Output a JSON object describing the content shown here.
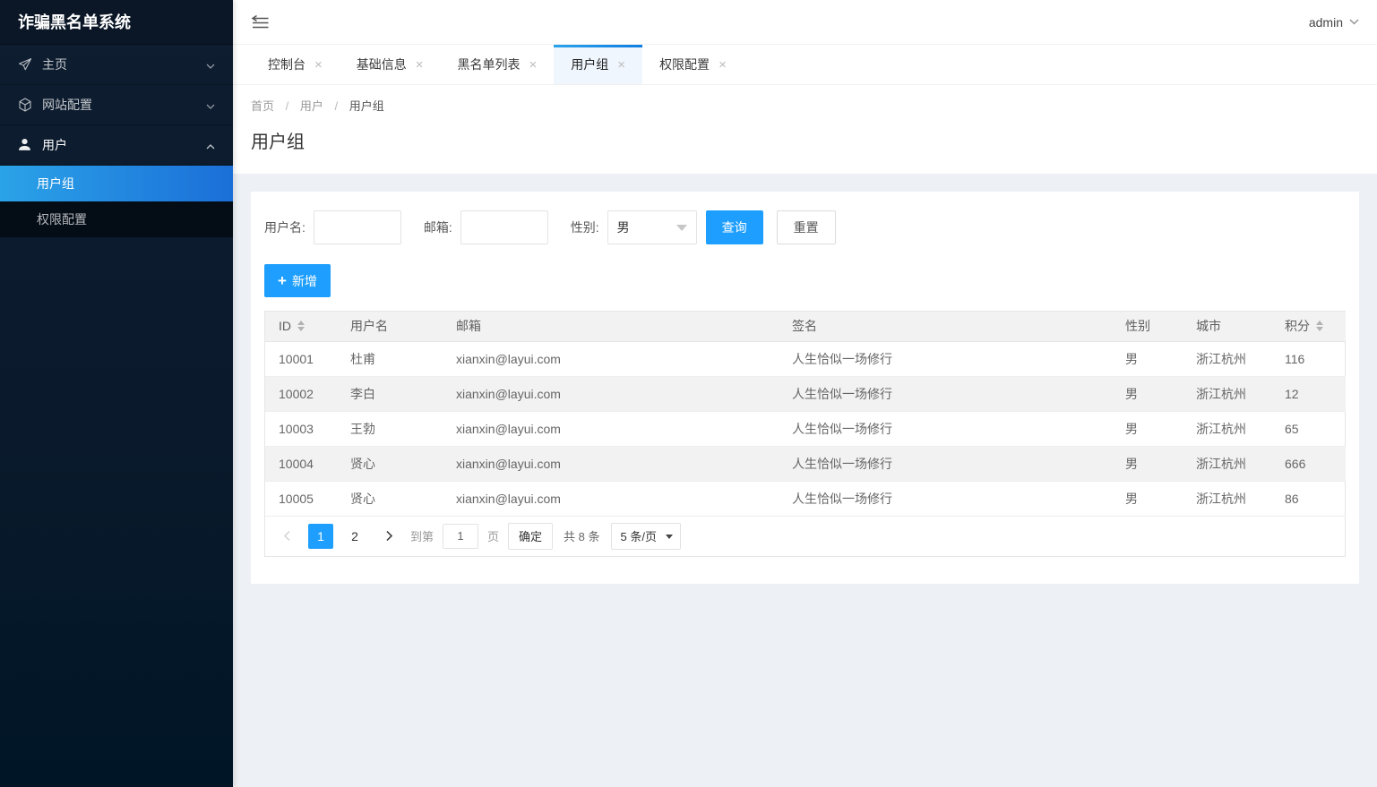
{
  "app": {
    "title": "诈骗黑名单系统"
  },
  "sidebar": {
    "items": [
      {
        "label": "主页",
        "icon": "paper-plane-icon",
        "state": "collapsed"
      },
      {
        "label": "网站配置",
        "icon": "cube-icon",
        "state": "collapsed"
      },
      {
        "label": "用户",
        "icon": "user-icon",
        "state": "expanded"
      }
    ],
    "submenu": [
      {
        "label": "用户组",
        "active": true
      },
      {
        "label": "权限配置",
        "active": false
      }
    ]
  },
  "topbar": {
    "user": "admin"
  },
  "tabs": [
    {
      "label": "控制台",
      "active": false
    },
    {
      "label": "基础信息",
      "active": false
    },
    {
      "label": "黑名单列表",
      "active": false
    },
    {
      "label": "用户组",
      "active": true
    },
    {
      "label": "权限配置",
      "active": false
    }
  ],
  "breadcrumb": [
    "首页",
    "用户",
    "用户组"
  ],
  "page": {
    "title": "用户组"
  },
  "search": {
    "username_label": "用户名:",
    "username_value": "",
    "email_label": "邮箱:",
    "email_value": "",
    "gender_label": "性别:",
    "gender_value": "男",
    "query_label": "查询",
    "reset_label": "重置"
  },
  "toolbar": {
    "add_label": "新增"
  },
  "table": {
    "headers": [
      "ID",
      "用户名",
      "邮箱",
      "签名",
      "性别",
      "城市",
      "积分"
    ],
    "sortable_columns": [
      "ID",
      "积分"
    ],
    "rows": [
      [
        "10001",
        "杜甫",
        "xianxin@layui.com",
        "人生恰似一场修行",
        "男",
        "浙江杭州",
        "116"
      ],
      [
        "10002",
        "李白",
        "xianxin@layui.com",
        "人生恰似一场修行",
        "男",
        "浙江杭州",
        "12"
      ],
      [
        "10003",
        "王勃",
        "xianxin@layui.com",
        "人生恰似一场修行",
        "男",
        "浙江杭州",
        "65"
      ],
      [
        "10004",
        "贤心",
        "xianxin@layui.com",
        "人生恰似一场修行",
        "男",
        "浙江杭州",
        "666"
      ],
      [
        "10005",
        "贤心",
        "xianxin@layui.com",
        "人生恰似一场修行",
        "男",
        "浙江杭州",
        "86"
      ]
    ]
  },
  "pagination": {
    "pages": [
      "1",
      "2"
    ],
    "current_page": "1",
    "goto_label": "到第",
    "goto_value": "1",
    "page_unit": "页",
    "confirm_label": "确定",
    "total_label": "共 8 条",
    "per_page": "5 条/页"
  },
  "colors": {
    "accent": "#1E9FFF",
    "sidebar_active_gradient_start": "#2BA3E8",
    "sidebar_active_gradient_end": "#1B6FD8",
    "active_tab_background": "#f0f6fd",
    "table_header_background": "#f2f2f2"
  }
}
